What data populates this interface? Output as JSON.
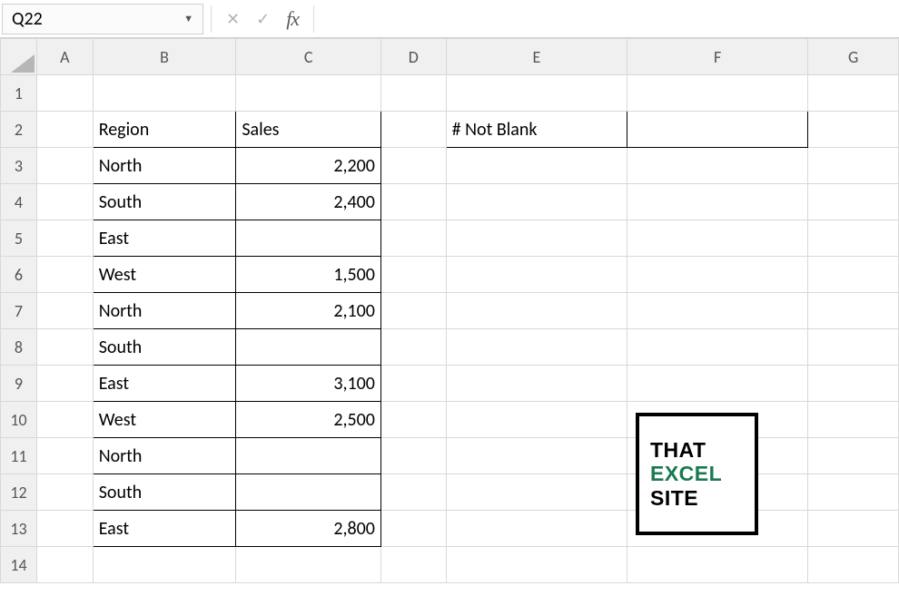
{
  "formulaBar": {
    "cellRef": "Q22",
    "cancelIcon": "✕",
    "confirmIcon": "✓",
    "fxLabel": "fx",
    "formula": ""
  },
  "columns": [
    "A",
    "B",
    "C",
    "D",
    "E",
    "F",
    "G"
  ],
  "rows": [
    "1",
    "2",
    "3",
    "4",
    "5",
    "6",
    "7",
    "8",
    "9",
    "10",
    "11",
    "12",
    "13",
    "14"
  ],
  "table1": {
    "header": {
      "region": "Region",
      "sales": "Sales"
    },
    "rows": [
      {
        "region": "North",
        "sales": "2,200"
      },
      {
        "region": "South",
        "sales": "2,400"
      },
      {
        "region": "East",
        "sales": ""
      },
      {
        "region": "West",
        "sales": "1,500"
      },
      {
        "region": "North",
        "sales": "2,100"
      },
      {
        "region": "South",
        "sales": ""
      },
      {
        "region": "East",
        "sales": "3,100"
      },
      {
        "region": "West",
        "sales": "2,500"
      },
      {
        "region": "North",
        "sales": ""
      },
      {
        "region": "South",
        "sales": ""
      },
      {
        "region": "East",
        "sales": "2,800"
      }
    ]
  },
  "summary": {
    "label": "# Not Blank",
    "value": ""
  },
  "logo": {
    "line1": "THAT",
    "line2": "EXCEL",
    "line3": "SITE"
  }
}
